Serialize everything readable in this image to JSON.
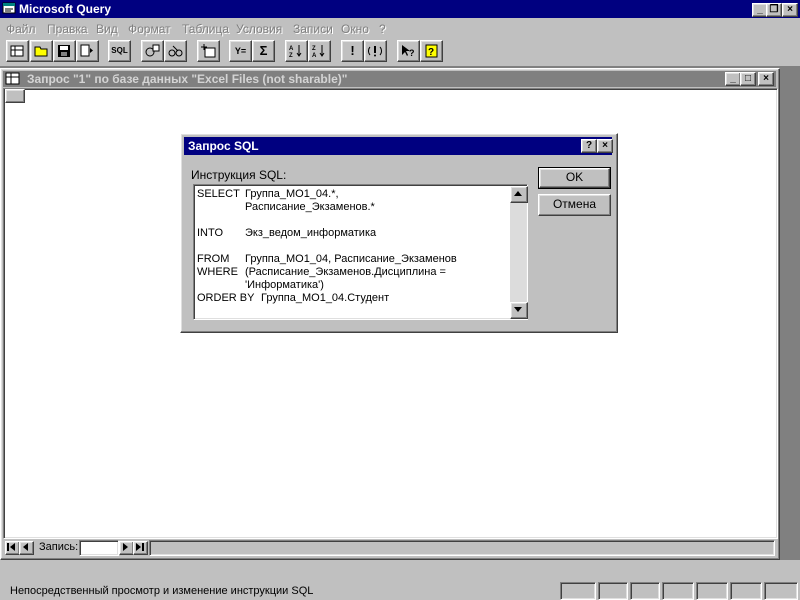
{
  "app": {
    "title": "Microsoft Query"
  },
  "menu": [
    "Файл",
    "Правка",
    "Вид",
    "Формат",
    "Таблица",
    "Условия",
    "Записи",
    "Окно",
    "?"
  ],
  "toolbar": {
    "sql_label": "SQL",
    "sigma": "Σ",
    "run": "!",
    "help_pointer": "?",
    "help": "?",
    "filter": "Y="
  },
  "query_window": {
    "title": "Запрос \"1\" по базе данных \"Excel Files (not sharable)\""
  },
  "record_nav": {
    "label": "Запись:",
    "value": ""
  },
  "sql_dialog": {
    "title": "Запрос SQL",
    "help_glyph": "?",
    "close_glyph": "×",
    "label": "Инструкция SQL:",
    "lines": [
      {
        "kw": "SELECT",
        "arg": "Группа_МО1_04.*,"
      },
      {
        "kw": "",
        "arg": "Расписание_Экзаменов.*"
      },
      {
        "kw": "",
        "arg": ""
      },
      {
        "kw": "INTO",
        "arg": "Экз_ведом_информатика"
      },
      {
        "kw": "",
        "arg": ""
      },
      {
        "kw": "FROM",
        "arg": "Группа_МО1_04, Расписание_Экзаменов"
      },
      {
        "kw": "WHERE",
        "arg": "(Расписание_Экзаменов.Дисциплина ="
      },
      {
        "kw": "",
        "arg": "'Информатика')"
      },
      {
        "kw": "ORDER BY",
        "arg": "Группа_МО1_04.Студент"
      }
    ],
    "ok_label": "OK",
    "cancel_label": "Отмена"
  },
  "status": {
    "text": "Непосредственный просмотр и изменение инструкции SQL"
  },
  "colors": {
    "titlebar_active": "#000080",
    "titlebar_inactive": "#808080",
    "face": "#c0c0c0"
  }
}
